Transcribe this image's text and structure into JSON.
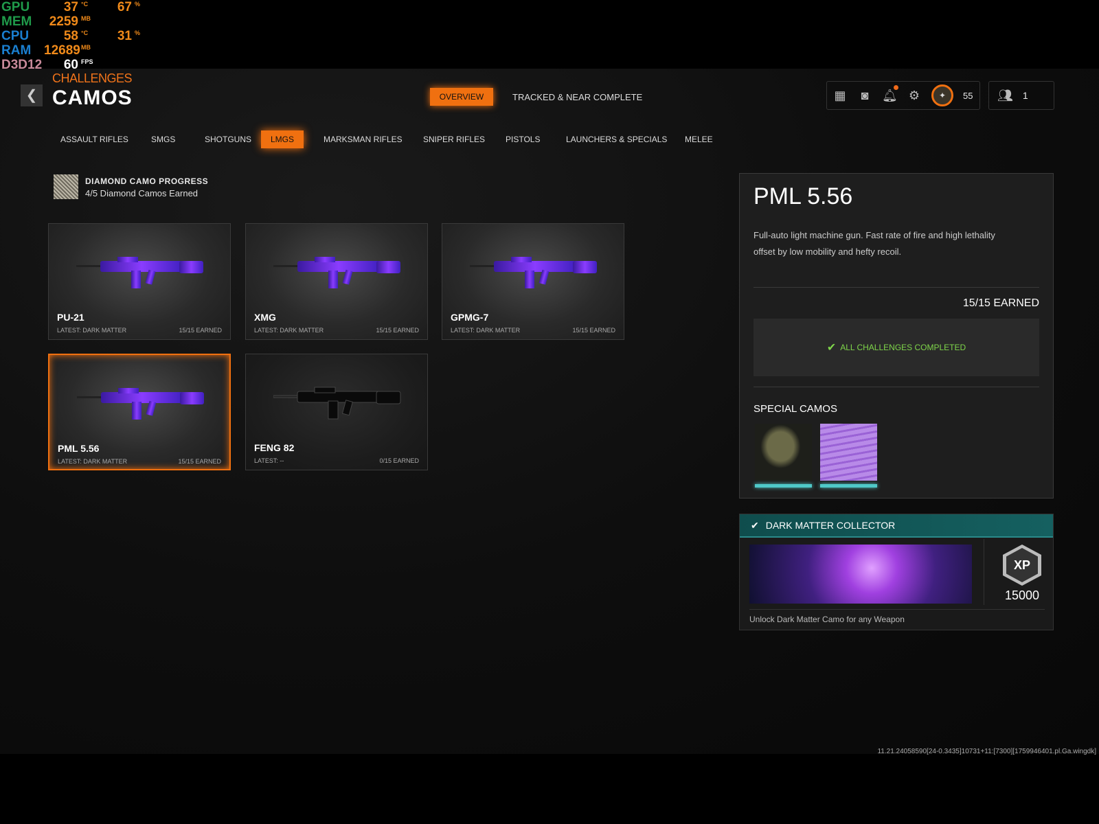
{
  "overlay": {
    "rows": [
      {
        "label": "GPU",
        "color": "#1f9a4a",
        "value": "37",
        "unit": "°C",
        "extra": "67",
        "extra_unit": "%"
      },
      {
        "label": "MEM",
        "color": "#1f9a4a",
        "value": "2259",
        "unit": "MB"
      },
      {
        "label": "CPU",
        "color": "#1a7fd0",
        "value": "58",
        "unit": "°C",
        "extra": "31",
        "extra_unit": "%"
      },
      {
        "label": "RAM",
        "color": "#1a7fd0",
        "value": "12689",
        "unit": "MB"
      },
      {
        "label": "D3D12",
        "color": "#c88a9a",
        "value": "60",
        "unit": "FPS"
      }
    ]
  },
  "header": {
    "pretitle": "CHALLENGES",
    "title": "CAMOS",
    "back": "❮",
    "tabs": [
      "OVERVIEW",
      "TRACKED & NEAR COMPLETE"
    ],
    "level": "55",
    "party_count": "1"
  },
  "categories": [
    "ASSAULT RIFLES",
    "SMGS",
    "SHOTGUNS",
    "LMGS",
    "MARKSMAN RIFLES",
    "SNIPER RIFLES",
    "PISTOLS",
    "LAUNCHERS & SPECIALS",
    "MELEE"
  ],
  "active_category": "LMGS",
  "diamond": {
    "title": "DIAMOND CAMO PROGRESS",
    "subtitle": "4/5 Diamond Camos Earned"
  },
  "weapons": [
    {
      "name": "PU-21",
      "latest": "LATEST: DARK MATTER",
      "earned": "15/15 EARNED"
    },
    {
      "name": "XMG",
      "latest": "LATEST: DARK MATTER",
      "earned": "15/15 EARNED"
    },
    {
      "name": "GPMG-7",
      "latest": "LATEST: DARK MATTER",
      "earned": "15/15 EARNED"
    },
    {
      "name": "PML 5.56",
      "latest": "LATEST: DARK MATTER",
      "earned": "15/15 EARNED"
    },
    {
      "name": "FENG 82",
      "latest": "LATEST: --",
      "earned": "0/15 EARNED"
    }
  ],
  "detail": {
    "name": "PML 5.56",
    "description": "Full-auto light machine gun.  Fast rate of fire and high lethality offset by low mobility and hefty recoil.",
    "earned": "15/15 EARNED",
    "status": "ALL CHALLENGES COMPLETED",
    "special_title": "SPECIAL CAMOS"
  },
  "collector": {
    "title": "DARK MATTER COLLECTOR",
    "xp": "15000",
    "xp_badge": "XP",
    "description": "Unlock Dark Matter Camo for any Weapon"
  },
  "footer": "11.21.24058590[24-0.3435]10731+11:[7300][1759946401.pl.Ga.wingdk]",
  "colors": {
    "accent": "#f07010",
    "teal": "#156060",
    "success": "#7fd64a"
  }
}
